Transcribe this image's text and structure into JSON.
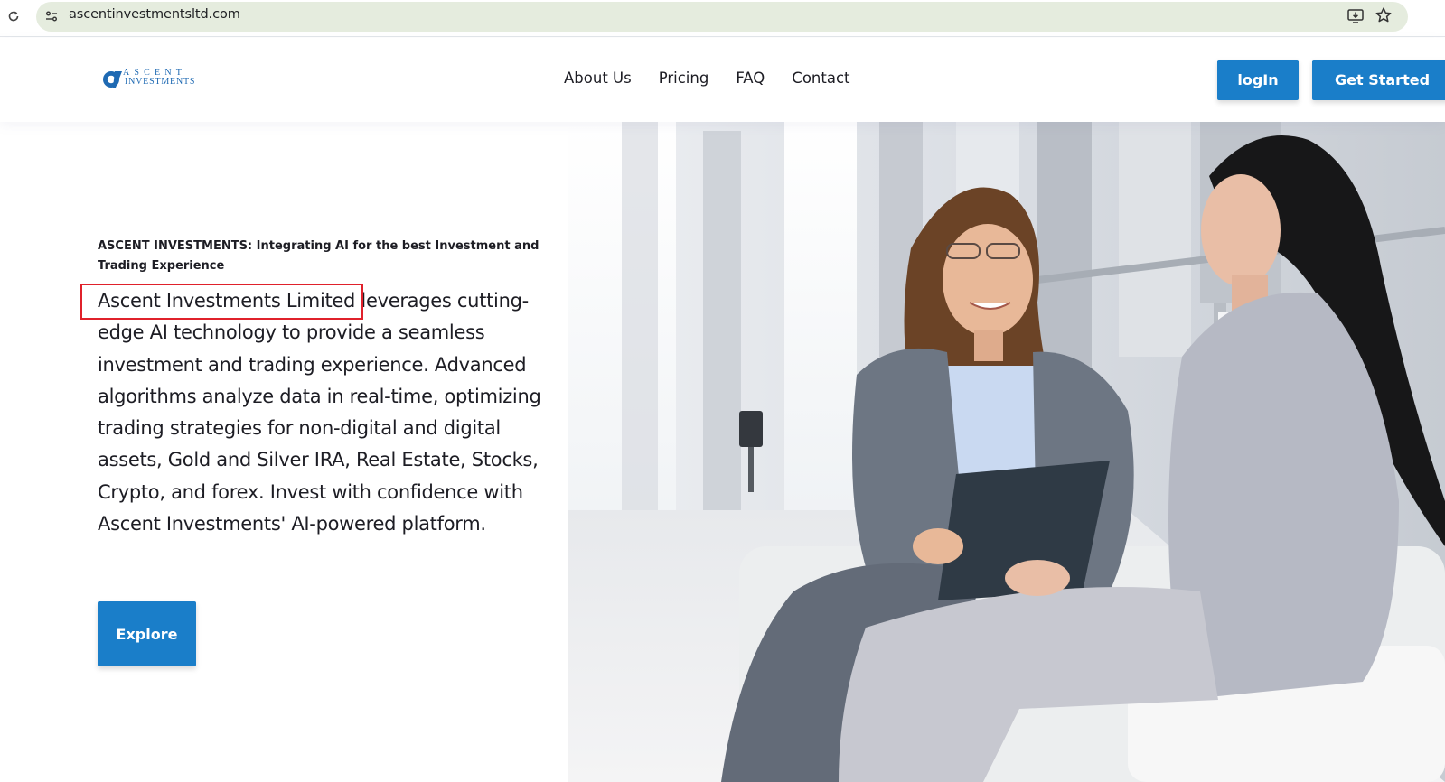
{
  "browser": {
    "url": "ascentinvestmentsltd.com"
  },
  "header": {
    "logo": {
      "line1": "ASCENT",
      "line2": "INVESTMENTS"
    },
    "nav": [
      {
        "label": "About Us"
      },
      {
        "label": "Pricing"
      },
      {
        "label": "FAQ"
      },
      {
        "label": "Contact"
      }
    ],
    "login_label": "logIn",
    "get_started_label": "Get Started"
  },
  "hero": {
    "eyebrow": "ASCENT INVESTMENTS: Integrating AI for the best Investment and Trading Experience",
    "body": "Ascent Investments Limited leverages cutting-edge AI technology to provide a seamless investment and trading experience. Advanced algorithms analyze data in real-time, optimizing trading strategies for non-digital and digital assets, Gold and Silver IRA, Real Estate, Stocks, Crypto, and forex. Invest with confidence with Ascent Investments' AI-powered platform.",
    "explore_label": "Explore",
    "image_subject": "two businesswomen in a meeting"
  },
  "colors": {
    "brand": "#1a7ec9",
    "highlight": "#e0212b"
  },
  "icons": [
    "reload-icon",
    "site-info-icon",
    "install-app-icon",
    "bookmark-star-icon",
    "logo-mark-icon"
  ]
}
